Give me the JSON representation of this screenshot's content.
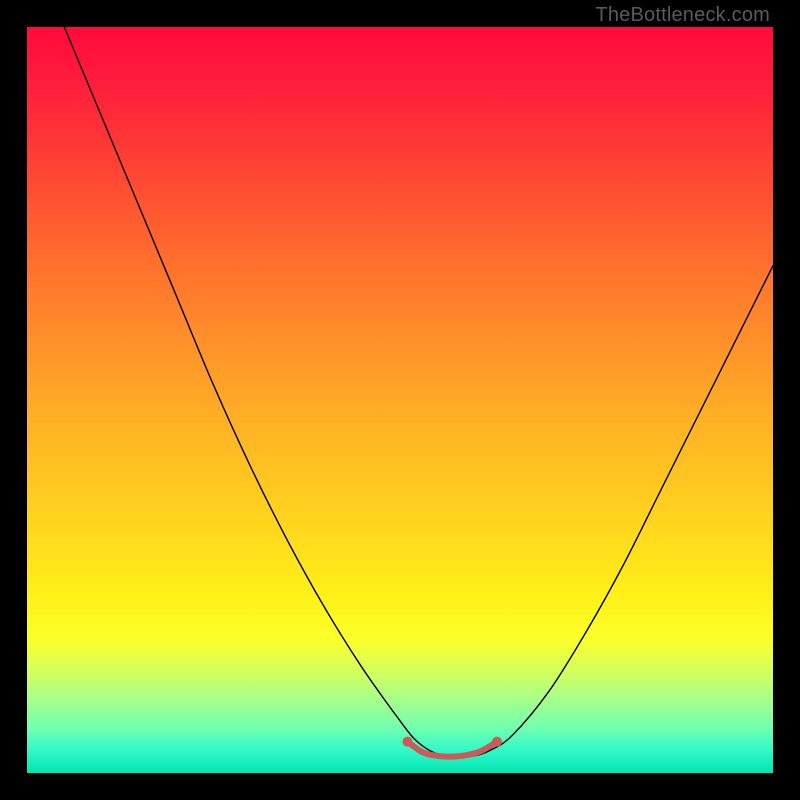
{
  "watermark": "TheBottleneck.com",
  "chart_data": {
    "type": "line",
    "title": "",
    "xlabel": "",
    "ylabel": "",
    "xlim": [
      0,
      100
    ],
    "ylim": [
      0,
      100
    ],
    "grid": false,
    "legend": false,
    "background_gradient": {
      "top_color": "#ff0a3c",
      "bottom_color": "#00e6b0",
      "description": "vertical red→orange→yellow→green gradient"
    },
    "series": [
      {
        "name": "main-curve",
        "color": "#000000",
        "stroke_width": 1.4,
        "x": [
          5,
          10,
          15,
          20,
          25,
          30,
          35,
          40,
          45,
          50,
          52,
          54,
          56,
          58,
          60,
          62,
          65,
          70,
          75,
          80,
          85,
          90,
          95,
          100
        ],
        "y": [
          100,
          88,
          76,
          64,
          52,
          41,
          31,
          22,
          14,
          7,
          4.5,
          3,
          2.3,
          2.2,
          2.3,
          3,
          5,
          11,
          19,
          28,
          38,
          48,
          58,
          68
        ]
      },
      {
        "name": "trough-highlight",
        "color": "#cc5a5a",
        "stroke_width": 6,
        "x": [
          51,
          53,
          55,
          57,
          59,
          61,
          63
        ],
        "y": [
          4.2,
          2.8,
          2.3,
          2.2,
          2.4,
          3.0,
          4.2
        ]
      }
    ],
    "markers": [
      {
        "x": 51,
        "y": 4.2,
        "color": "#cc5a5a",
        "r": 5
      },
      {
        "x": 63,
        "y": 4.2,
        "color": "#cc5a5a",
        "r": 5
      }
    ]
  }
}
